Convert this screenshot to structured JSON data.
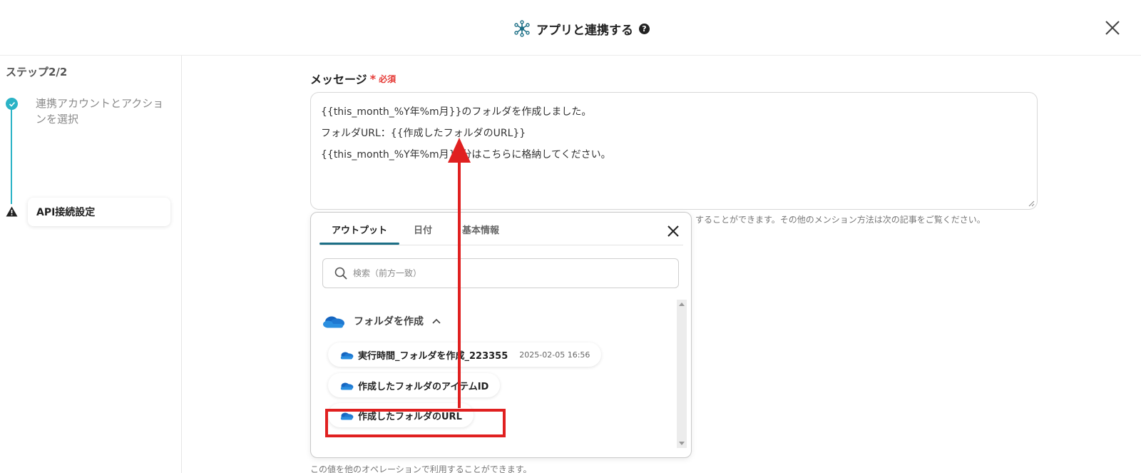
{
  "header": {
    "title": "アプリと連携する",
    "help": "?"
  },
  "sidebar": {
    "step_count": "ステップ2/2",
    "steps": [
      {
        "label": "連携アカウントとアクションを選択",
        "status": "done"
      },
      {
        "label": "API接続設定",
        "status": "current"
      }
    ]
  },
  "main": {
    "field_label": "メッセージ",
    "required_mark": "*",
    "required_text": "必須",
    "message_lines": [
      "{{this_month_%Y年%m月}}のフォルダを作成しました。",
      "フォルダURL：{{作成したフォルダのURL}}",
      "{{this_month_%Y年%m月}}分はこちらに格納してください。"
    ],
    "hint_right": "することができます。その他のメンション方法は次の記事をご覧ください。",
    "hint_bottom": "この値を他のオペレーションで利用することができます。"
  },
  "popup": {
    "tabs": [
      {
        "label": "アウトプット",
        "active": true
      },
      {
        "label": "日付",
        "active": false
      },
      {
        "label": "基本情報",
        "active": false
      }
    ],
    "search_placeholder": "検索（前方一致）",
    "group": {
      "name": "フォルダを作成",
      "icon": "onedrive-cloud-icon"
    },
    "items": [
      {
        "label": "実行時間_フォルダを作成_223355",
        "value": "2025-02-05 16:56"
      },
      {
        "label": "作成したフォルダのアイテムID",
        "value": ""
      },
      {
        "label": "作成したフォルダのURL",
        "value": "",
        "highlighted": true
      }
    ]
  },
  "colors": {
    "accent": "#2bb3c6",
    "tab_underline": "#1d6f86",
    "required": "#e53935",
    "annotation": "#e02020",
    "cloud": "#1f78d1"
  }
}
